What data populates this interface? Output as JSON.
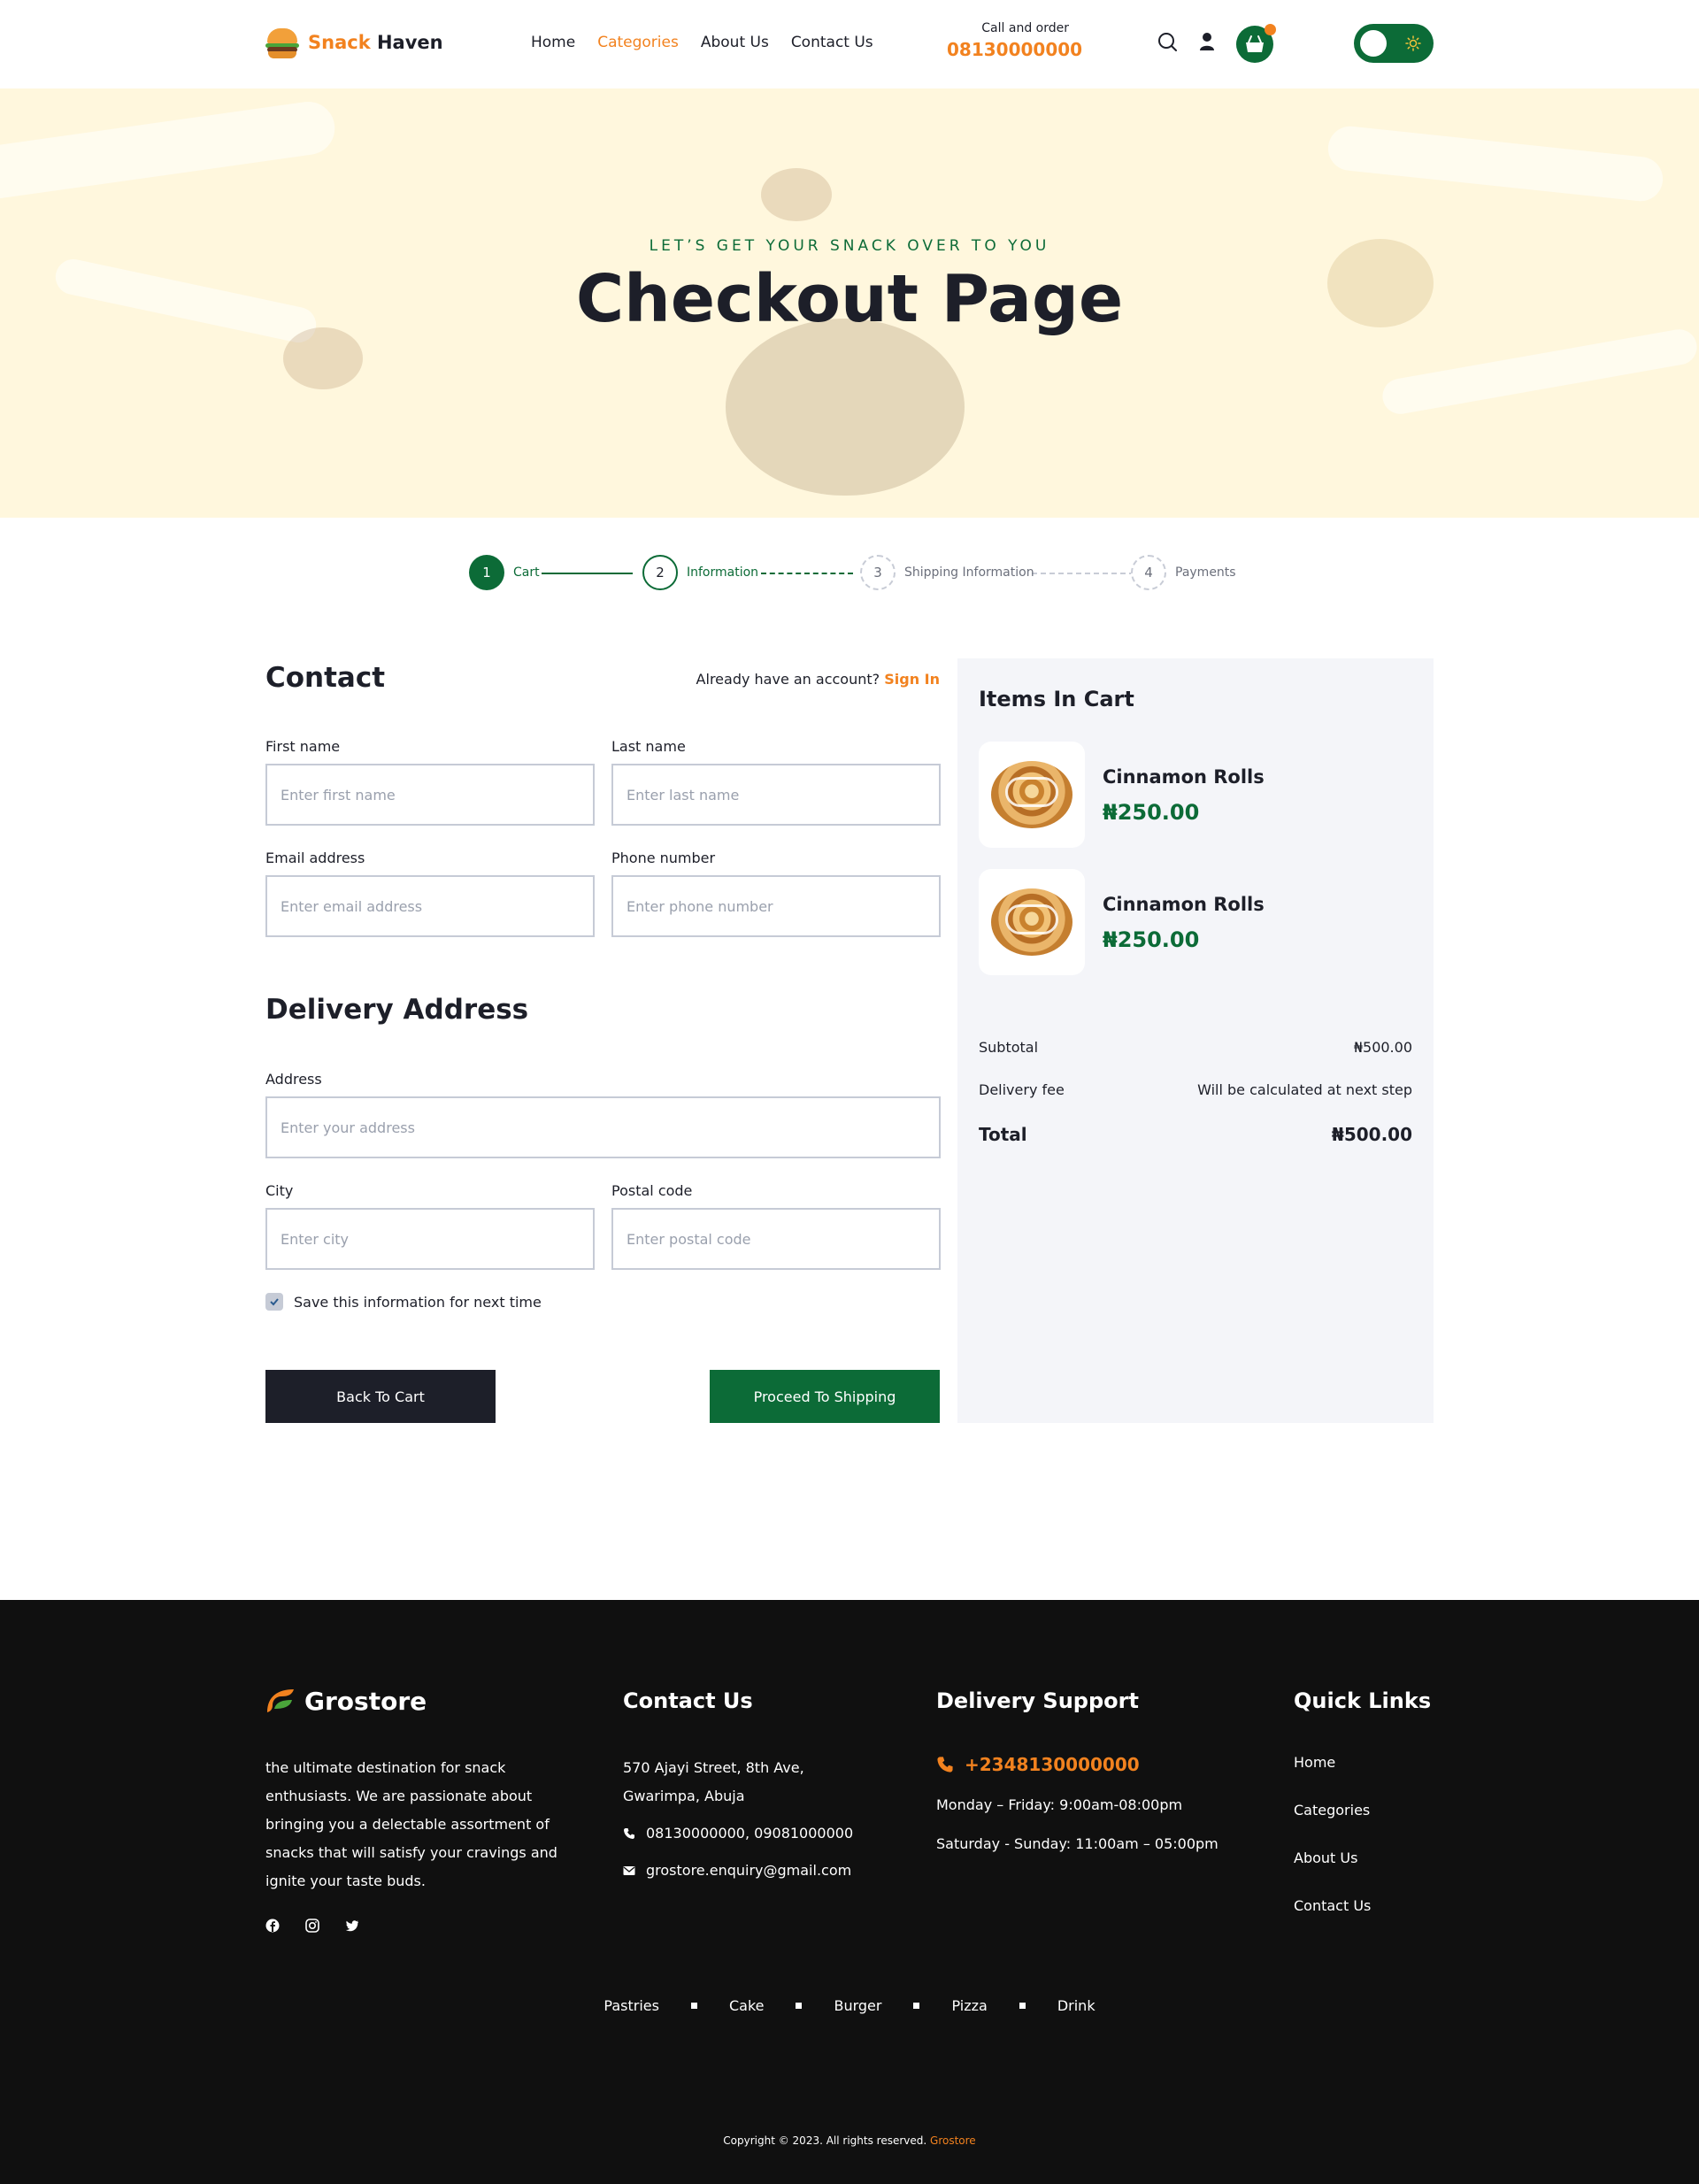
{
  "header": {
    "brand_part1": "Snack",
    "brand_part2": "Haven",
    "nav": [
      "Home",
      "Categories",
      "About Us",
      "Contact Us"
    ],
    "active_nav": "Categories",
    "call_label": "Call and order",
    "call_number": "08130000000",
    "cart_icon": "shopping-basket-icon",
    "search_icon": "search-icon",
    "user_icon": "user-icon",
    "theme_toggle_icon": "sun-icon"
  },
  "hero": {
    "subtitle": "LET’S GET YOUR SNACK OVER TO YOU",
    "title": "Checkout Page"
  },
  "stepper": [
    {
      "number": "1",
      "label": "Cart",
      "state": "done"
    },
    {
      "number": "2",
      "label": "Information",
      "state": "active"
    },
    {
      "number": "3",
      "label": "Shipping Information",
      "state": "todo"
    },
    {
      "number": "4",
      "label": "Payments",
      "state": "todo"
    }
  ],
  "contact": {
    "title": "Contact",
    "account_prompt": "Already have an account?",
    "sign_in": "Sign In",
    "first_name_label": "First name",
    "first_name_placeholder": "Enter first name",
    "last_name_label": "Last name",
    "last_name_placeholder": "Enter last name",
    "email_label": "Email address",
    "email_placeholder": "Enter email address",
    "phone_label": "Phone number",
    "phone_placeholder": "Enter phone number"
  },
  "delivery": {
    "title": "Delivery Address",
    "address_label": "Address",
    "address_placeholder": "Enter your address",
    "city_label": "City",
    "city_placeholder": "Enter city",
    "postal_label": "Postal code",
    "postal_placeholder": "Enter postal code",
    "save_info_label": "Save this information for next time",
    "save_info_checked": true
  },
  "buttons": {
    "back": "Back To Cart",
    "proceed": "Proceed To Shipping"
  },
  "cart": {
    "title": "Items In Cart",
    "items": [
      {
        "name": "Cinnamon Rolls",
        "price": "₦250.00"
      },
      {
        "name": "Cinnamon Rolls",
        "price": "₦250.00"
      }
    ],
    "subtotal_label": "Subtotal",
    "subtotal_value": "₦500.00",
    "delivery_label": "Delivery fee",
    "delivery_value": "Will be calculated at next step",
    "total_label": "Total",
    "total_value": "₦500.00"
  },
  "footer": {
    "brand": "Grostore",
    "description": "the ultimate destination for snack enthusiasts. We are passionate about bringing you a delectable assortment of snacks that will satisfy your cravings and ignite your taste buds.",
    "social": [
      "facebook-icon",
      "instagram-icon",
      "twitter-icon"
    ],
    "contact_title": "Contact Us",
    "address": "570 Ajayi Street, 8th Ave, Gwarimpa, Abuja",
    "phones": "08130000000,  09081000000",
    "email": "grostore.enquiry@gmail.com",
    "support_title": "Delivery Support",
    "support_phone": "+2348130000000",
    "hours_weekday": "Monday – Friday: 9:00am-08:00pm",
    "hours_weekend": "Saturday - Sunday: 11:00am – 05:00pm",
    "links_title": "Quick Links",
    "links": [
      "Home",
      "Categories",
      "About Us",
      "Contact Us"
    ],
    "categories": [
      "Pastries",
      "Cake",
      "Burger",
      "Pizza",
      "Drink"
    ],
    "copyright": "Copyright © 2023. All rights reserved.",
    "copyright_brand": "Grostore"
  },
  "colors": {
    "accent_orange": "#f2821f",
    "brand_green": "#0c6b37",
    "dark": "#1d1f29",
    "footer_bg": "#101010",
    "hero_bg": "#fff7dd"
  }
}
